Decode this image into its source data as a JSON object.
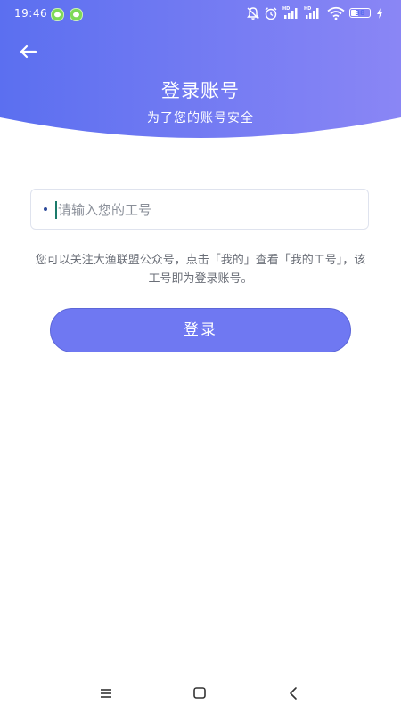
{
  "status_bar": {
    "time": "19:46",
    "battery_level": "38",
    "battery_fraction": 0.38,
    "network_labels": [
      "HD",
      "HD"
    ],
    "icons": [
      "wechat-icon",
      "wechat-icon",
      "mute-icon",
      "alarm-icon",
      "signal-icon",
      "signal-icon",
      "wifi-icon",
      "battery-icon",
      "charging-icon"
    ]
  },
  "header": {
    "back_icon": "arrow-left-icon",
    "title": "登录账号",
    "subtitle": "为了您的账号安全",
    "gradient_colors": [
      "#5b6ff0",
      "#8a86f5"
    ]
  },
  "form": {
    "employee_id": {
      "value": "",
      "placeholder": "请输入您的工号"
    },
    "hint": "您可以关注大渔联盟公众号，点击「我的」查看「我的工号」，该工号即为登录账号。",
    "login_button": "登录"
  },
  "nav_bar": {
    "icons": [
      "menu-icon",
      "home-square-icon",
      "back-chevron-icon"
    ]
  },
  "colors": {
    "accent": "#6f78f2",
    "hint_text": "#6b6f78"
  }
}
